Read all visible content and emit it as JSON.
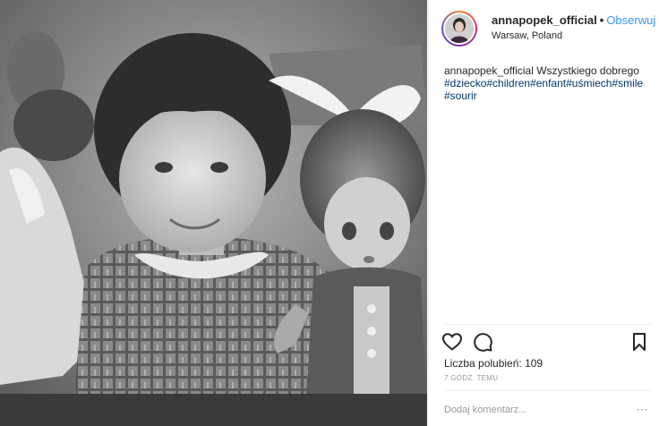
{
  "post": {
    "photo": {
      "description_icon": "photo-image"
    },
    "header": {
      "username": "annapopek_official",
      "separator": "•",
      "follow_label": "Obserwuj",
      "location": "Warsaw, Poland"
    },
    "caption": {
      "author": "annapopek_official",
      "text": " Wszystkiego dobrego",
      "hashtags": [
        "#dziecko",
        "#children",
        "#enfant",
        "#uśmiech",
        "#smile",
        "#sourir"
      ]
    },
    "actions": {
      "like_icon": "heart-icon",
      "comment_icon": "comment-icon",
      "save_icon": "bookmark-icon"
    },
    "likes_label": "Liczba polubień: 109",
    "time_label": "7 GODZ. TEMU",
    "comment": {
      "placeholder": "Dodaj komentarz...",
      "more_label": "⋯"
    },
    "colors": {
      "link": "#3897f0",
      "hashtag": "#003569",
      "text": "#262626",
      "muted": "#999999"
    }
  }
}
